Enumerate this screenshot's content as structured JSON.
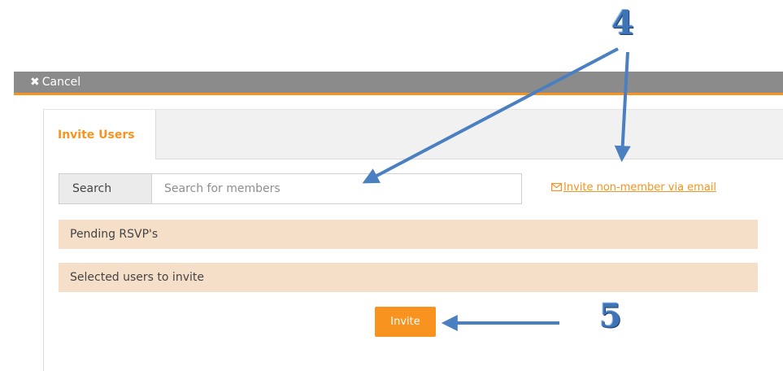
{
  "header": {
    "cancel_icon": "✖",
    "cancel_label": "Cancel"
  },
  "tabs": [
    {
      "label": "Invite Users",
      "active": true
    }
  ],
  "search": {
    "addon_label": "Search",
    "placeholder": "Search for members",
    "value": ""
  },
  "invite_email": {
    "icon": "envelope-icon",
    "label": "Invite non-member via email"
  },
  "sections": {
    "pending": "Pending RSVP's",
    "selected": "Selected users to invite"
  },
  "actions": {
    "invite_label": "Invite"
  },
  "annotations": {
    "step_4": "4",
    "step_5": "5"
  },
  "colors": {
    "accent": "#f7931e",
    "titlebar": "#8b8b8b",
    "band": "#f6dfc9",
    "annotation": "#3f74b6"
  }
}
